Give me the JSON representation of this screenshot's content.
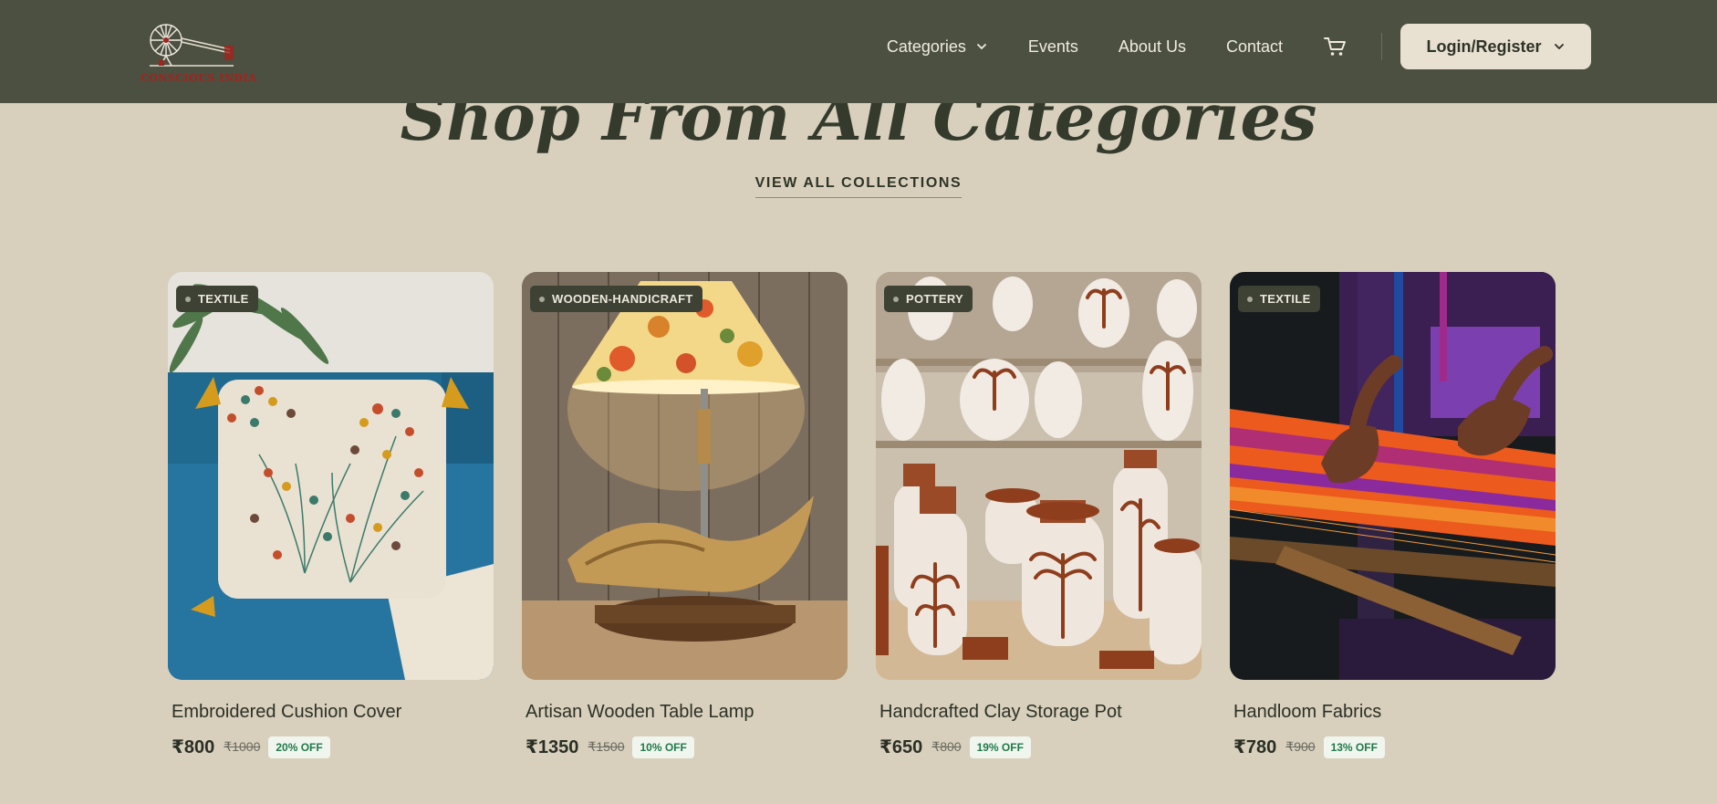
{
  "brand": {
    "logo_text": "CONSCIOUS INDIA",
    "logo_icon": "charkha-spinning-wheel-icon"
  },
  "nav": {
    "items": [
      {
        "label": "Categories",
        "has_dropdown": true
      },
      {
        "label": "Events"
      },
      {
        "label": "About Us"
      },
      {
        "label": "Contact"
      }
    ],
    "cart_icon": "cart-icon",
    "login_label": "Login/Register"
  },
  "section": {
    "title": "Shop From All Categories",
    "view_all_label": "VIEW ALL COLLECTIONS"
  },
  "products": [
    {
      "tag": "TEXTILE",
      "name": "Embroidered Cushion Cover",
      "price": "₹800",
      "original_price": "₹1000",
      "discount": "20% OFF"
    },
    {
      "tag": "WOODEN-HANDICRAFT",
      "name": "Artisan Wooden Table Lamp",
      "price": "₹1350",
      "original_price": "₹1500",
      "discount": "10% OFF"
    },
    {
      "tag": "POTTERY",
      "name": "Handcrafted Clay Storage Pot",
      "price": "₹650",
      "original_price": "₹800",
      "discount": "19% OFF"
    },
    {
      "tag": "TEXTILE",
      "name": "Handloom Fabrics",
      "price": "₹780",
      "original_price": "₹900",
      "discount": "13% OFF"
    }
  ],
  "colors": {
    "header_bg": "#4c5041",
    "page_bg": "#d8d0bd",
    "tag_bg": "#3d4234",
    "discount_text": "#1f7a4a"
  }
}
